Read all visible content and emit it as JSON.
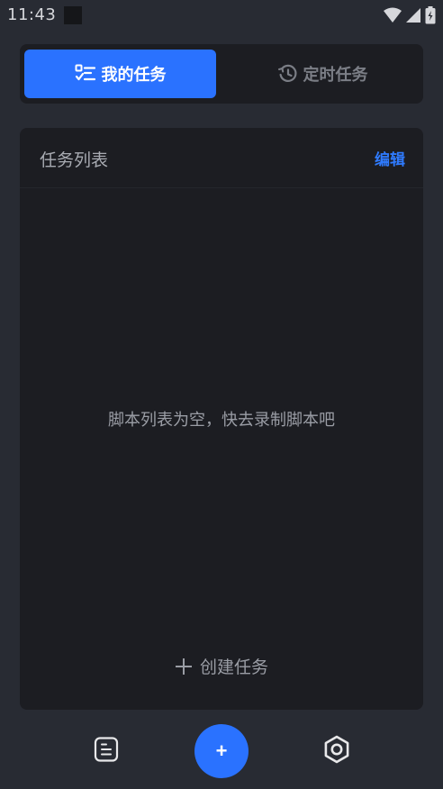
{
  "status_bar": {
    "time": "11:43"
  },
  "tabs": [
    {
      "label": "我的任务",
      "icon": "checklist-icon",
      "active": true
    },
    {
      "label": "定时任务",
      "icon": "clock-history-icon",
      "active": false
    }
  ],
  "card": {
    "title": "任务列表",
    "edit_label": "编辑",
    "empty_message": "脚本列表为空，快去录制脚本吧",
    "create_label": "创建任务"
  },
  "fab": {
    "label": "+"
  },
  "colors": {
    "accent": "#2a72ff",
    "background": "#282b33",
    "card": "#1c1d22"
  }
}
